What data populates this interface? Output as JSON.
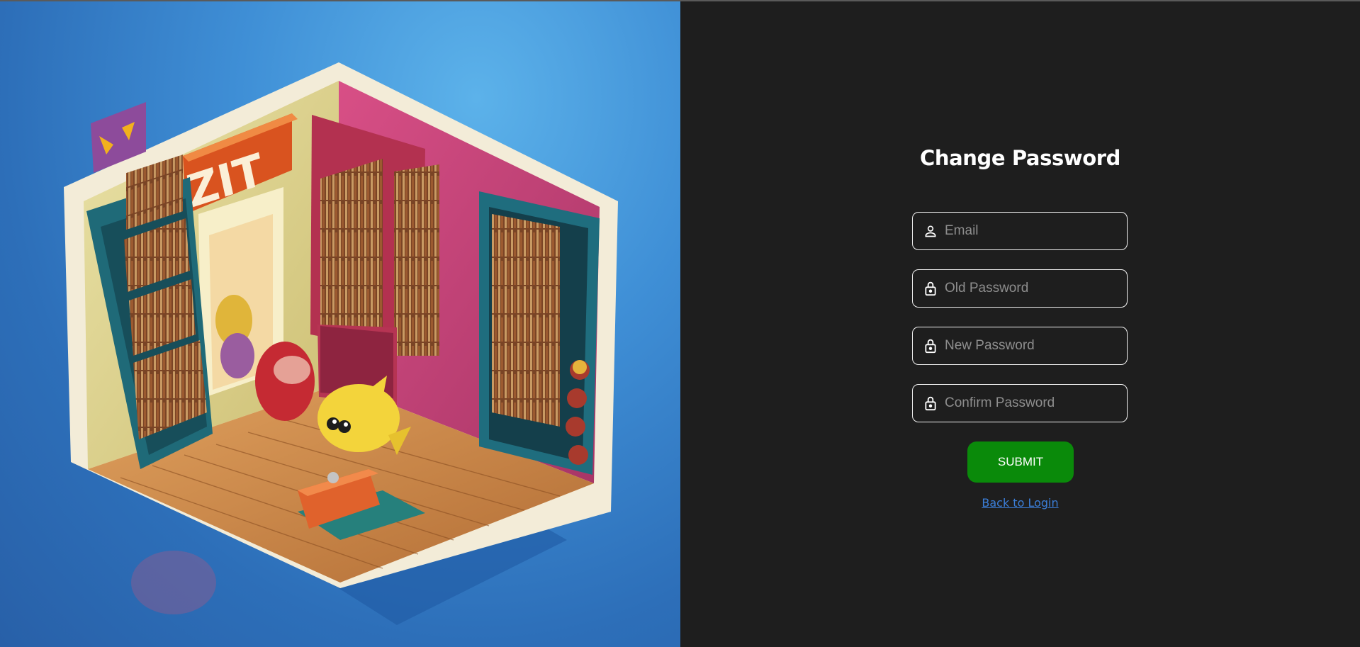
{
  "hero": {
    "sign_text": "ZIT"
  },
  "form": {
    "title": "Change Password",
    "fields": [
      {
        "placeholder": "Email",
        "icon": "user-icon"
      },
      {
        "placeholder": "Old Password",
        "icon": "lock-icon"
      },
      {
        "placeholder": "New Password",
        "icon": "lock-icon"
      },
      {
        "placeholder": "Confirm Password",
        "icon": "lock-icon"
      }
    ],
    "submit_label": "SUBMIT",
    "back_link": "Back to Login"
  },
  "colors": {
    "background": "#1e1e1e",
    "submit": "#0a8a0a",
    "link": "#3b7ed8",
    "field_border": "#f2f2f2"
  }
}
